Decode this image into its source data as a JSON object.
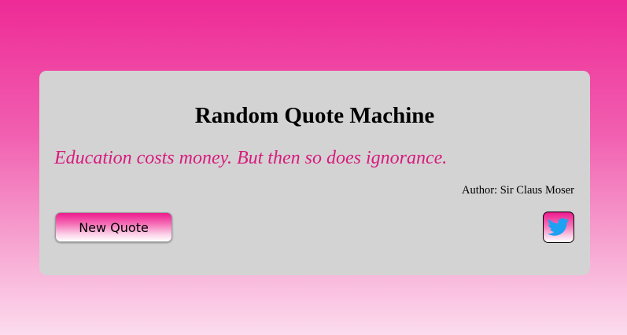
{
  "app": {
    "title": "Random Quote Machine"
  },
  "quote": {
    "text": "Education costs money. But then so does ignorance.",
    "author_line": "Author: Sir Claus Moser"
  },
  "actions": {
    "new_quote_label": "New Quote",
    "tweet_icon": "twitter-bird-icon"
  },
  "colors": {
    "page_gradient_top": "#ee2a96",
    "page_gradient_bottom": "#fcdcee",
    "card_background": "#d3d3d3",
    "quote_text": "#d81b7e",
    "twitter_blue": "#1da1f2"
  }
}
